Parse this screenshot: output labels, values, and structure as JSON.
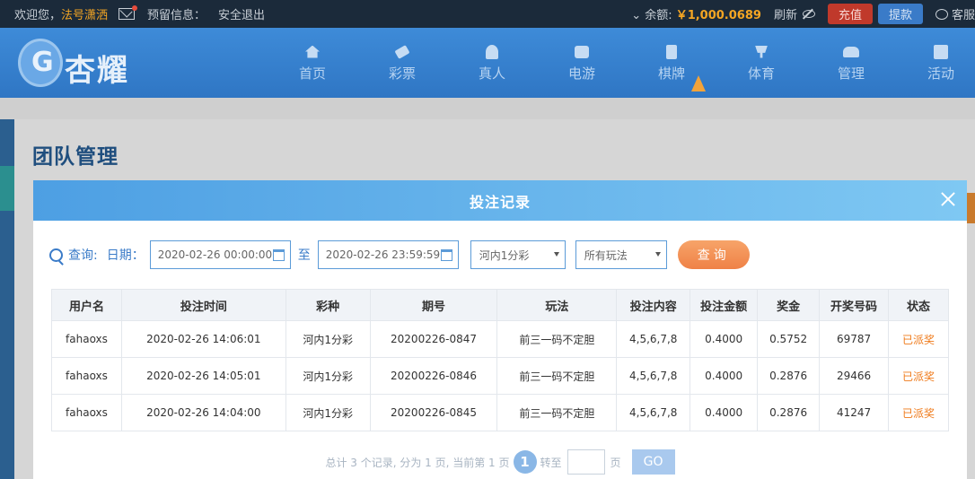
{
  "topbar": {
    "welcome": "欢迎您，",
    "username": "法号潇洒",
    "notice": "预留信息：",
    "logout": "安全退出",
    "balance_label": "余额:",
    "balance_value": "￥1,000.0689",
    "refresh": "刷新",
    "deposit": "充值",
    "withdraw": "提款",
    "service": "客服"
  },
  "logo": {
    "text": "杏耀"
  },
  "nav": {
    "items": [
      {
        "label": "首页",
        "icon": "home-icon"
      },
      {
        "label": "彩票",
        "icon": "lottery-icon"
      },
      {
        "label": "真人",
        "icon": "live-casino-icon"
      },
      {
        "label": "电游",
        "icon": "slot-game-icon"
      },
      {
        "label": "棋牌",
        "icon": "card-game-icon"
      },
      {
        "label": "体育",
        "icon": "trophy-icon"
      },
      {
        "label": "管理",
        "icon": "users-icon"
      },
      {
        "label": "活动",
        "icon": "gift-icon"
      }
    ]
  },
  "page": {
    "title": "团队管理"
  },
  "modal": {
    "title": "投注记录",
    "filter": {
      "query_label": "查询:",
      "date_label": "日期：",
      "start_date": "2020-02-26 00:00:00",
      "to_label": "至",
      "end_date": "2020-02-26 23:59:59",
      "lottery_select": "河内1分彩",
      "play_select": "所有玩法",
      "query_button": "查询"
    },
    "table": {
      "headers": [
        "用户名",
        "投注时间",
        "彩种",
        "期号",
        "玩法",
        "投注内容",
        "投注金额",
        "奖金",
        "开奖号码",
        "状态"
      ],
      "rows": [
        [
          "fahaoxs",
          "2020-02-26 14:06:01",
          "河内1分彩",
          "20200226-0847",
          "前三一码不定胆",
          "4,5,6,7,8",
          "0.4000",
          "0.5752",
          "69787",
          "已派奖"
        ],
        [
          "fahaoxs",
          "2020-02-26 14:05:01",
          "河内1分彩",
          "20200226-0846",
          "前三一码不定胆",
          "4,5,6,7,8",
          "0.4000",
          "0.2876",
          "29466",
          "已派奖"
        ],
        [
          "fahaoxs",
          "2020-02-26 14:04:00",
          "河内1分彩",
          "20200226-0845",
          "前三一码不定胆",
          "4,5,6,7,8",
          "0.4000",
          "0.2876",
          "41247",
          "已派奖"
        ]
      ]
    },
    "pager": {
      "summary": "总计 3 个记录, 分为 1 页, 当前第 1 页",
      "current_page": "1",
      "jump_label": "转至",
      "page_unit": "页",
      "go": "GO"
    }
  },
  "colors": {
    "nav_bg": "#3e8bd8",
    "accent_blue": "#3a7bc8",
    "status_orange": "#ef7a1a",
    "query_button": "#ef8146"
  }
}
